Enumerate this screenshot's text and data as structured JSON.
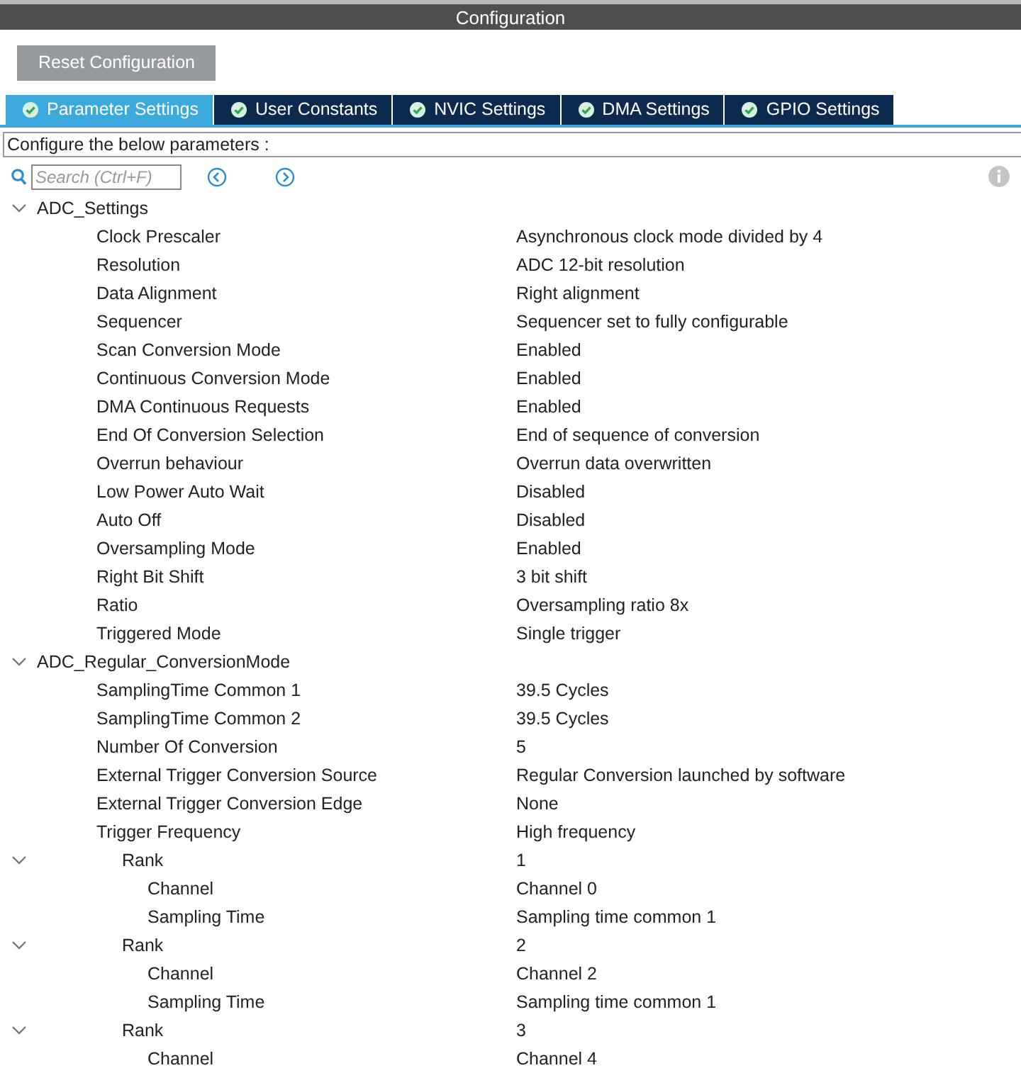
{
  "window": {
    "title": "Configuration"
  },
  "reset_button": "Reset Configuration",
  "tabs": [
    {
      "label": "Parameter Settings",
      "selected": true
    },
    {
      "label": "User Constants",
      "selected": false
    },
    {
      "label": "NVIC Settings",
      "selected": false
    },
    {
      "label": "DMA Settings",
      "selected": false
    },
    {
      "label": "GPIO Settings",
      "selected": false
    }
  ],
  "description": "Configure the below parameters :",
  "search": {
    "placeholder": "Search (Ctrl+F)"
  },
  "tree": [
    {
      "label": "ADC_Settings",
      "expanded": true,
      "children": [
        {
          "label": "Clock Prescaler",
          "value": "Asynchronous clock mode divided by 4"
        },
        {
          "label": "Resolution",
          "value": "ADC 12-bit resolution"
        },
        {
          "label": "Data Alignment",
          "value": "Right alignment"
        },
        {
          "label": "Sequencer",
          "value": "Sequencer set to fully configurable"
        },
        {
          "label": "Scan Conversion Mode",
          "value": "Enabled"
        },
        {
          "label": "Continuous Conversion Mode",
          "value": "Enabled"
        },
        {
          "label": "DMA Continuous Requests",
          "value": "Enabled"
        },
        {
          "label": "End Of Conversion Selection",
          "value": "End of sequence of conversion"
        },
        {
          "label": "Overrun behaviour",
          "value": "Overrun data overwritten"
        },
        {
          "label": "Low Power Auto Wait",
          "value": "Disabled"
        },
        {
          "label": "Auto Off",
          "value": "Disabled"
        },
        {
          "label": "Oversampling Mode",
          "value": "Enabled"
        },
        {
          "label": "Right Bit Shift",
          "value": "3 bit shift"
        },
        {
          "label": "Ratio",
          "value": "Oversampling ratio 8x"
        },
        {
          "label": "Triggered Mode",
          "value": "Single trigger"
        }
      ]
    },
    {
      "label": "ADC_Regular_ConversionMode",
      "expanded": true,
      "children": [
        {
          "label": "SamplingTime Common 1",
          "value": "39.5 Cycles"
        },
        {
          "label": "SamplingTime Common 2",
          "value": "39.5 Cycles"
        },
        {
          "label": "Number Of Conversion",
          "value": "5"
        },
        {
          "label": "External Trigger Conversion Source",
          "value": "Regular Conversion launched by software"
        },
        {
          "label": "External Trigger Conversion Edge",
          "value": "None"
        },
        {
          "label": "Trigger Frequency",
          "value": "High frequency"
        },
        {
          "label": "Rank",
          "value": "1",
          "expanded": true,
          "children": [
            {
              "label": "Channel",
              "value": "Channel 0"
            },
            {
              "label": "Sampling Time",
              "value": "Sampling time common 1"
            }
          ]
        },
        {
          "label": "Rank",
          "value": "2",
          "expanded": true,
          "children": [
            {
              "label": "Channel",
              "value": "Channel 2"
            },
            {
              "label": "Sampling Time",
              "value": "Sampling time common 1"
            }
          ]
        },
        {
          "label": "Rank",
          "value": "3",
          "expanded": true,
          "children": [
            {
              "label": "Channel",
              "value": "Channel 4"
            }
          ]
        }
      ]
    }
  ]
}
